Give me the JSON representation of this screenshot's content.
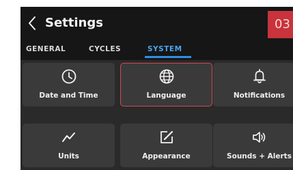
{
  "header": {
    "title": "Settings",
    "time_partial": "03"
  },
  "tabs": [
    {
      "label": "GENERAL",
      "active": false
    },
    {
      "label": "CYCLES",
      "active": false
    },
    {
      "label": "SYSTEM",
      "active": true
    }
  ],
  "tiles": [
    {
      "label": "Date and Time",
      "icon": "clock-icon",
      "selected": false
    },
    {
      "label": "Language",
      "icon": "globe-icon",
      "selected": true
    },
    {
      "label": "Notifications",
      "icon": "bell-icon",
      "selected": false
    },
    {
      "label": "Units",
      "icon": "chart-line-icon",
      "selected": false
    },
    {
      "label": "Appearance",
      "icon": "edit-square-icon",
      "selected": false
    },
    {
      "label": "Sounds + Alerts",
      "icon": "speaker-icon",
      "selected": false
    }
  ],
  "colors": {
    "background": "#161616",
    "tile": "#3a3a3a",
    "active_tab": "#4aa3f0",
    "selected_border": "#d04a55",
    "badge": "#c8333c"
  }
}
